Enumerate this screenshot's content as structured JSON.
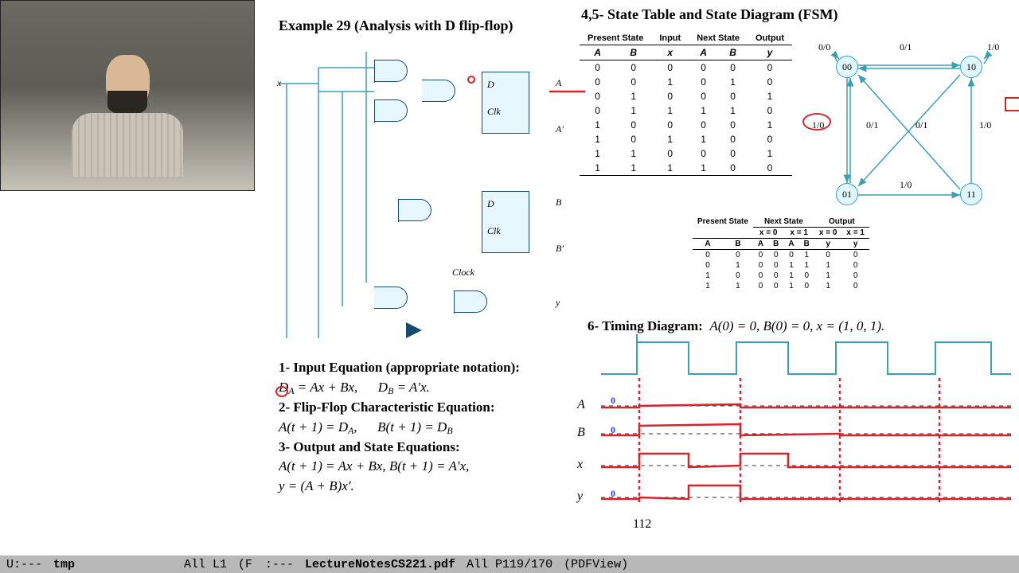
{
  "titles": {
    "example": "Example 29 (Analysis with D flip-flop)",
    "section45": "4,5- State Table and State Diagram (FSM)",
    "section6": "6- Timing Diagram:",
    "timing_cond": "A(0) = 0,  B(0) = 0,  x = (1, 0, 1)."
  },
  "eq_headers": {
    "h1": "1- Input Equation (appropriate notation):",
    "h2": "2- Flip-Flop Characteristic Equation:",
    "h3": "3- Output and State Equations:"
  },
  "equations": {
    "da": "D",
    "da_sub": "A",
    "da_rhs": " = Ax + Bx,",
    "db": "D",
    "db_sub": "B",
    "db_rhs": " = A′x.",
    "at1": "A(t + 1) = D",
    "at1_sub": "A",
    "at1_tail": ",",
    "bt1": "B(t + 1) = D",
    "bt1_sub": "B",
    "at2": "A(t + 1) = Ax + Bx,    B(t + 1) = A′x,",
    "y": "y = (A + B)x′."
  },
  "state_table": {
    "groups": [
      "Present State",
      "Input",
      "Next State",
      "Output"
    ],
    "cols": [
      "A",
      "B",
      "x",
      "A",
      "B",
      "y"
    ],
    "rows": [
      [
        "0",
        "0",
        "0",
        "0",
        "0",
        "0"
      ],
      [
        "0",
        "0",
        "1",
        "0",
        "1",
        "0"
      ],
      [
        "0",
        "1",
        "0",
        "0",
        "0",
        "1"
      ],
      [
        "0",
        "1",
        "1",
        "1",
        "1",
        "0"
      ],
      [
        "1",
        "0",
        "0",
        "0",
        "0",
        "1"
      ],
      [
        "1",
        "0",
        "1",
        "1",
        "0",
        "0"
      ],
      [
        "1",
        "1",
        "0",
        "0",
        "0",
        "1"
      ],
      [
        "1",
        "1",
        "1",
        "1",
        "0",
        "0"
      ]
    ]
  },
  "compact_table": {
    "groups": [
      "Present State",
      "Next State",
      "Output"
    ],
    "sub1": [
      "",
      "x = 0",
      "x = 1",
      "x = 0",
      "x = 1"
    ],
    "cols": [
      "A",
      "B",
      "A",
      "B",
      "A",
      "B",
      "y",
      "y"
    ],
    "rows": [
      [
        "0",
        "0",
        "0",
        "0",
        "0",
        "1",
        "0",
        "0"
      ],
      [
        "0",
        "1",
        "0",
        "0",
        "1",
        "1",
        "1",
        "0"
      ],
      [
        "1",
        "0",
        "0",
        "0",
        "1",
        "0",
        "1",
        "0"
      ],
      [
        "1",
        "1",
        "0",
        "0",
        "1",
        "0",
        "1",
        "0"
      ]
    ]
  },
  "state_diagram": {
    "nodes": {
      "n00": "00",
      "n01": "01",
      "n10": "10",
      "n11": "11"
    },
    "edges": {
      "e00self": "0/0",
      "e00_01": "1/0",
      "e01_00": "0/1",
      "e10_00": "0/1",
      "e11_00": "0/1",
      "e01_11": "1/0",
      "e11_10": "1/0",
      "e10self": "1/0"
    }
  },
  "ff": {
    "d": "D",
    "clk": "Clk",
    "clock": "Clock",
    "x": "x",
    "y": "y",
    "A": "A",
    "Ap": "A′",
    "B": "B",
    "Bp": "B′"
  },
  "timing_labels": {
    "A": "A",
    "B": "B",
    "x": "x",
    "y": "y"
  },
  "page_num": "112",
  "status_left": {
    "mode": "U:---",
    "buf": "tmp",
    "pos": "All L1",
    "tail": "(F"
  },
  "status_right": {
    "mode": ":---",
    "file": "LectureNotesCS221.pdf",
    "pos": "All P119/170",
    "view": "(PDFView)"
  }
}
